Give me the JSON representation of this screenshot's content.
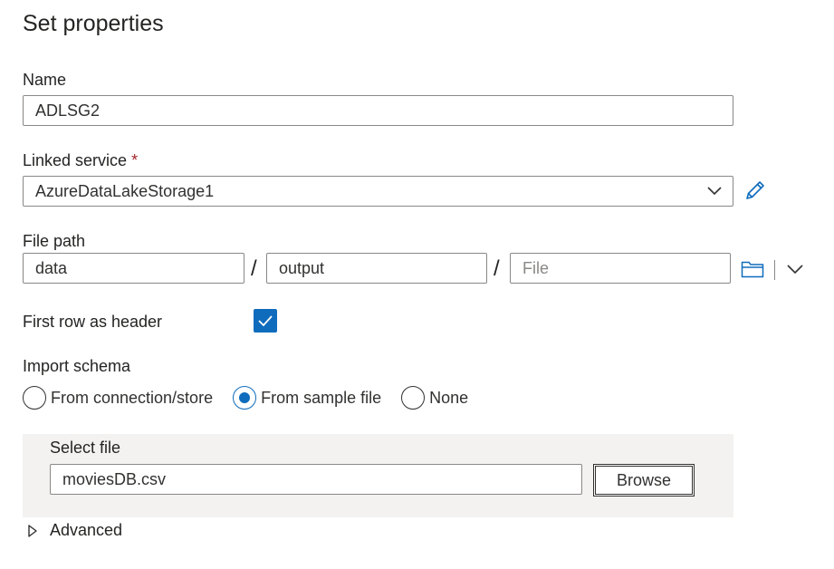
{
  "page": {
    "title": "Set properties"
  },
  "name_field": {
    "label": "Name",
    "value": "ADLSG2"
  },
  "linked_service": {
    "label": "Linked service",
    "required_marker": "*",
    "value": "AzureDataLakeStorage1"
  },
  "file_path": {
    "label": "File path",
    "container_value": "data",
    "separator": "/",
    "directory_value": "output",
    "file_placeholder": "File"
  },
  "first_row_header": {
    "label": "First row as header",
    "checked": true
  },
  "import_schema": {
    "label": "Import schema",
    "options": [
      {
        "label": "From connection/store",
        "selected": false
      },
      {
        "label": "From sample file",
        "selected": true
      },
      {
        "label": "None",
        "selected": false
      }
    ]
  },
  "select_file": {
    "label": "Select file",
    "value": "moviesDB.csv",
    "browse_label": "Browse"
  },
  "advanced": {
    "label": "Advanced",
    "expanded": false
  },
  "colors": {
    "accent": "#0f6cbd",
    "required": "#a4262c",
    "panel_bg": "#f3f2f1",
    "border": "#8a8886"
  }
}
